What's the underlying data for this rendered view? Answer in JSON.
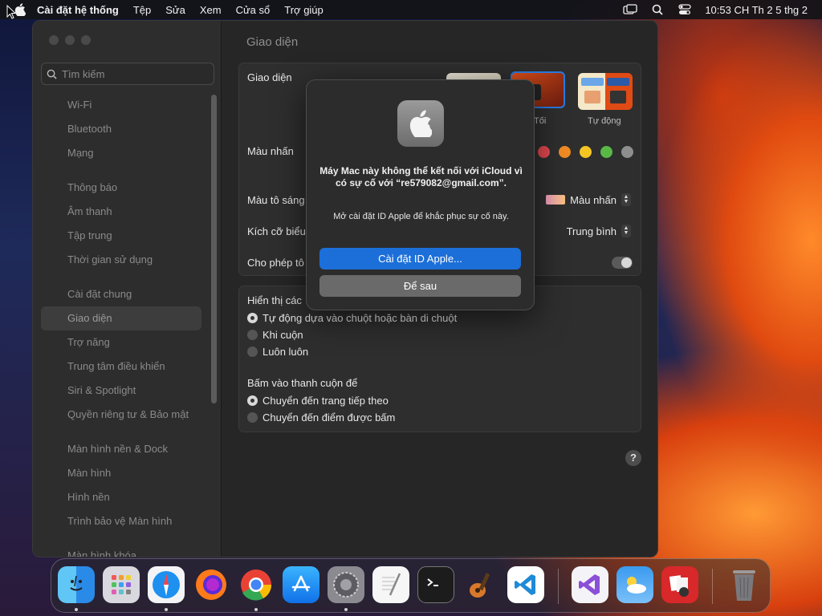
{
  "menubar": {
    "app_name": "Cài đặt hệ thống",
    "menus": [
      "Tệp",
      "Sửa",
      "Xem",
      "Cửa sổ",
      "Trợ giúp"
    ],
    "clock": "10:53 CH Th 2 5 thg 2"
  },
  "sidebar": {
    "search_placeholder": "Tìm kiếm",
    "groups": [
      [
        "Wi-Fi",
        "Bluetooth",
        "Mạng"
      ],
      [
        "Thông báo",
        "Âm thanh",
        "Tập trung",
        "Thời gian sử dụng"
      ],
      [
        "Cài đặt chung",
        "Giao diện",
        "Trợ năng",
        "Trung tâm điều khiển",
        "Siri & Spotlight",
        "Quyền riêng tư & Bảo mật"
      ],
      [
        "Màn hình nền & Dock",
        "Màn hình",
        "Hình nền",
        "Trình bảo vệ Màn hình"
      ],
      [
        "Màn hình khóa"
      ]
    ],
    "active": "Giao diện"
  },
  "main": {
    "title": "Giao diện",
    "appearance_label": "Giao diện",
    "appearance_options": [
      "Tối",
      "Tự động"
    ],
    "accent_label": "Màu nhấn",
    "accent_colors": [
      "#e0484f",
      "#f08a24",
      "#f6c524",
      "#58b947",
      "#8e8e8e"
    ],
    "highlight_label": "Màu tô sáng",
    "highlight_value": "Màu nhấn",
    "icon_size_label": "Kích cỡ biểu",
    "icon_size_value": "Trung bình",
    "allow_label": "Cho phép tô",
    "scroll_show_label": "Hiển thị các",
    "scroll_show_options": [
      "Tự động dựa vào chuột hoặc bàn di chuột",
      "Khi cuộn",
      "Luôn luôn"
    ],
    "scroll_click_label": "Bấm vào thanh cuộn để",
    "scroll_click_options": [
      "Chuyển đến trang tiếp theo",
      "Chuyển đến điểm được bấm"
    ],
    "help": "?"
  },
  "dialog": {
    "message": "Máy Mac này không thể kết nối với iCloud vì có sự cố với “re579082@gmail.com”.",
    "info": "Mở cài đặt ID Apple để khắc phục sự cố này.",
    "primary_button": "Cài đặt ID Apple...",
    "secondary_button": "Để sau"
  },
  "dock": {
    "apps": [
      "Finder",
      "Launchpad",
      "Safari",
      "Firefox",
      "Chrome",
      "App Store",
      "System Settings",
      "TextEdit",
      "Terminal",
      "GarageBand",
      "Visual Studio Code",
      "Visual Studio",
      "Weather",
      "Photo Booth",
      "Trash"
    ]
  }
}
